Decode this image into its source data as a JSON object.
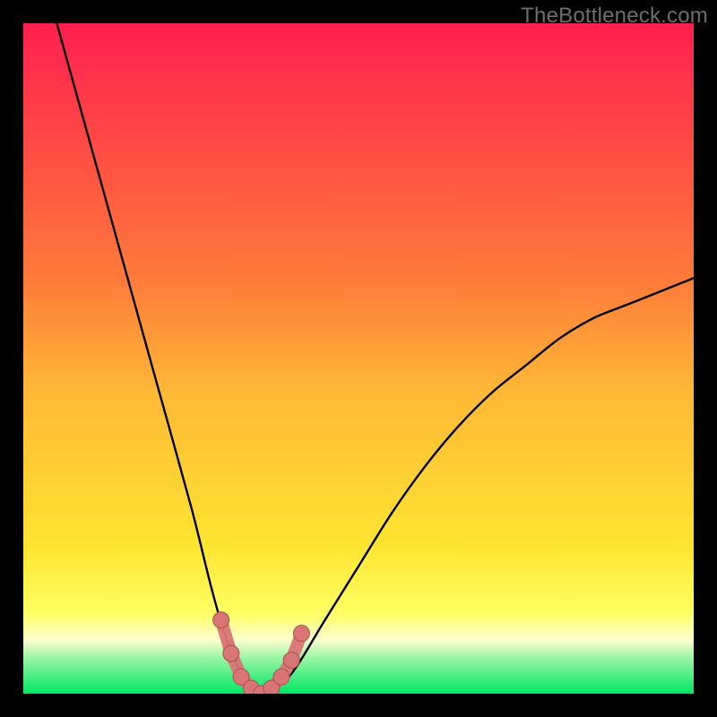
{
  "watermark": "TheBottleneck.com",
  "colors": {
    "gradient_top": "#ff1f4f",
    "gradient_mid_upper": "#ff7a3a",
    "gradient_mid": "#ffd531",
    "gradient_lower_yellow": "#ffff63",
    "gradient_pale": "#fdffd0",
    "gradient_green": "#00e763",
    "curve": "#000000",
    "marker_fill": "#da7575",
    "marker_stroke": "#a85050"
  },
  "chart_data": {
    "type": "line",
    "title": "",
    "xlabel": "",
    "ylabel": "",
    "xlim": [
      0,
      100
    ],
    "ylim": [
      0,
      100
    ],
    "series": [
      {
        "name": "bottleneck-curve",
        "x": [
          5,
          10,
          15,
          20,
          25,
          28,
          30,
          32,
          34,
          35,
          36,
          38,
          40,
          42,
          45,
          50,
          55,
          60,
          65,
          70,
          75,
          80,
          85,
          90,
          95,
          100
        ],
        "values": [
          100,
          82,
          64,
          46,
          28,
          16,
          9,
          4,
          1,
          0,
          0,
          1,
          3,
          6,
          11,
          19,
          27,
          34,
          40,
          45,
          49,
          53,
          56,
          58,
          60,
          62
        ]
      }
    ],
    "markers": {
      "name": "highlighted-points",
      "x": [
        29.5,
        31,
        32.5,
        34,
        35.5,
        37,
        38.5,
        40,
        41.5
      ],
      "values": [
        11,
        6,
        2.5,
        0.8,
        0,
        0.8,
        2.5,
        5,
        9
      ]
    },
    "gradient_stops_pct": [
      0,
      38,
      55,
      78,
      88,
      92,
      94.5,
      100
    ],
    "gradient_colors": [
      "#ff1f4f",
      "#ff7a3a",
      "#ffb836",
      "#ffe531",
      "#ffff63",
      "#fdffd0",
      "#9ff5a8",
      "#00e763"
    ]
  }
}
